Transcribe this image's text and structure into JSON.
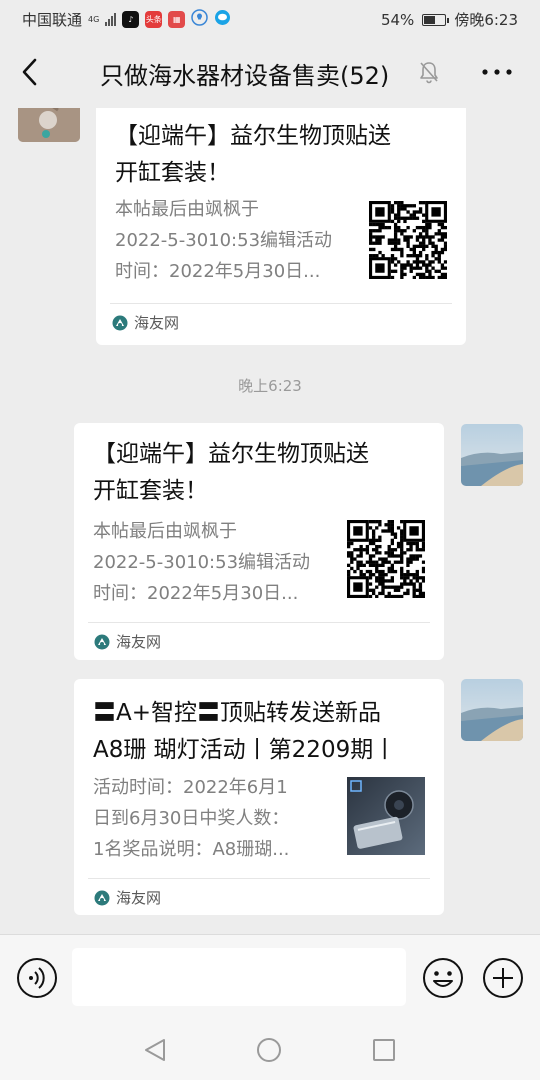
{
  "status_bar": {
    "carrier": "中国联通",
    "network": "4G",
    "battery_percent": "54%",
    "battery_level": 0.54,
    "time": "傍晚6:23",
    "app_icons": [
      "tiktok-icon",
      "toutiao-icon",
      "news-icon",
      "bulb-icon",
      "chat-icon"
    ],
    "toutiao_label": "头条"
  },
  "header": {
    "title": "只做海水器材设备售卖(52)",
    "icons": [
      "back-icon",
      "mute-bell-icon",
      "more-icon"
    ]
  },
  "messages": [
    {
      "side": "left",
      "title_lines": [
        "【迎端午】益尔生物顶贴送",
        "开缸套装！"
      ],
      "desc_lines": [
        "本帖最后由飒枫于",
        "2022-5-3010:53编辑活动",
        "时间：2022年5月30日..."
      ],
      "thumbnail": "qr-code",
      "source": "海友网"
    },
    {
      "type": "timestamp",
      "text": "晚上6:23"
    },
    {
      "side": "right",
      "title_lines": [
        "【迎端午】益尔生物顶贴送",
        "开缸套装！"
      ],
      "desc_lines": [
        "本帖最后由飒枫于",
        "2022-5-3010:53编辑活动",
        "时间：2022年5月30日..."
      ],
      "thumbnail": "qr-code",
      "source": "海友网"
    },
    {
      "side": "right",
      "title_lines": [
        "〓A+智控〓顶贴转发送新品",
        "A8珊 瑚灯活动丨第2209期丨"
      ],
      "desc_lines": [
        "活动时间：2022年6月1",
        "日到6月30日中奖人数：",
        "1名奖品说明：A8珊瑚..."
      ],
      "thumbnail": "product-image",
      "source": "海友网"
    }
  ],
  "input_bar": {
    "placeholder": "",
    "icons": [
      "voice-icon",
      "emoji-icon",
      "plus-icon"
    ]
  },
  "nav_bar": {
    "icons": [
      "nav-back-icon",
      "nav-home-icon",
      "nav-recent-icon"
    ]
  },
  "colors": {
    "background": "#ededed",
    "card": "#ffffff",
    "muted_text": "#808080",
    "source_icon": "#2c7a7b"
  }
}
